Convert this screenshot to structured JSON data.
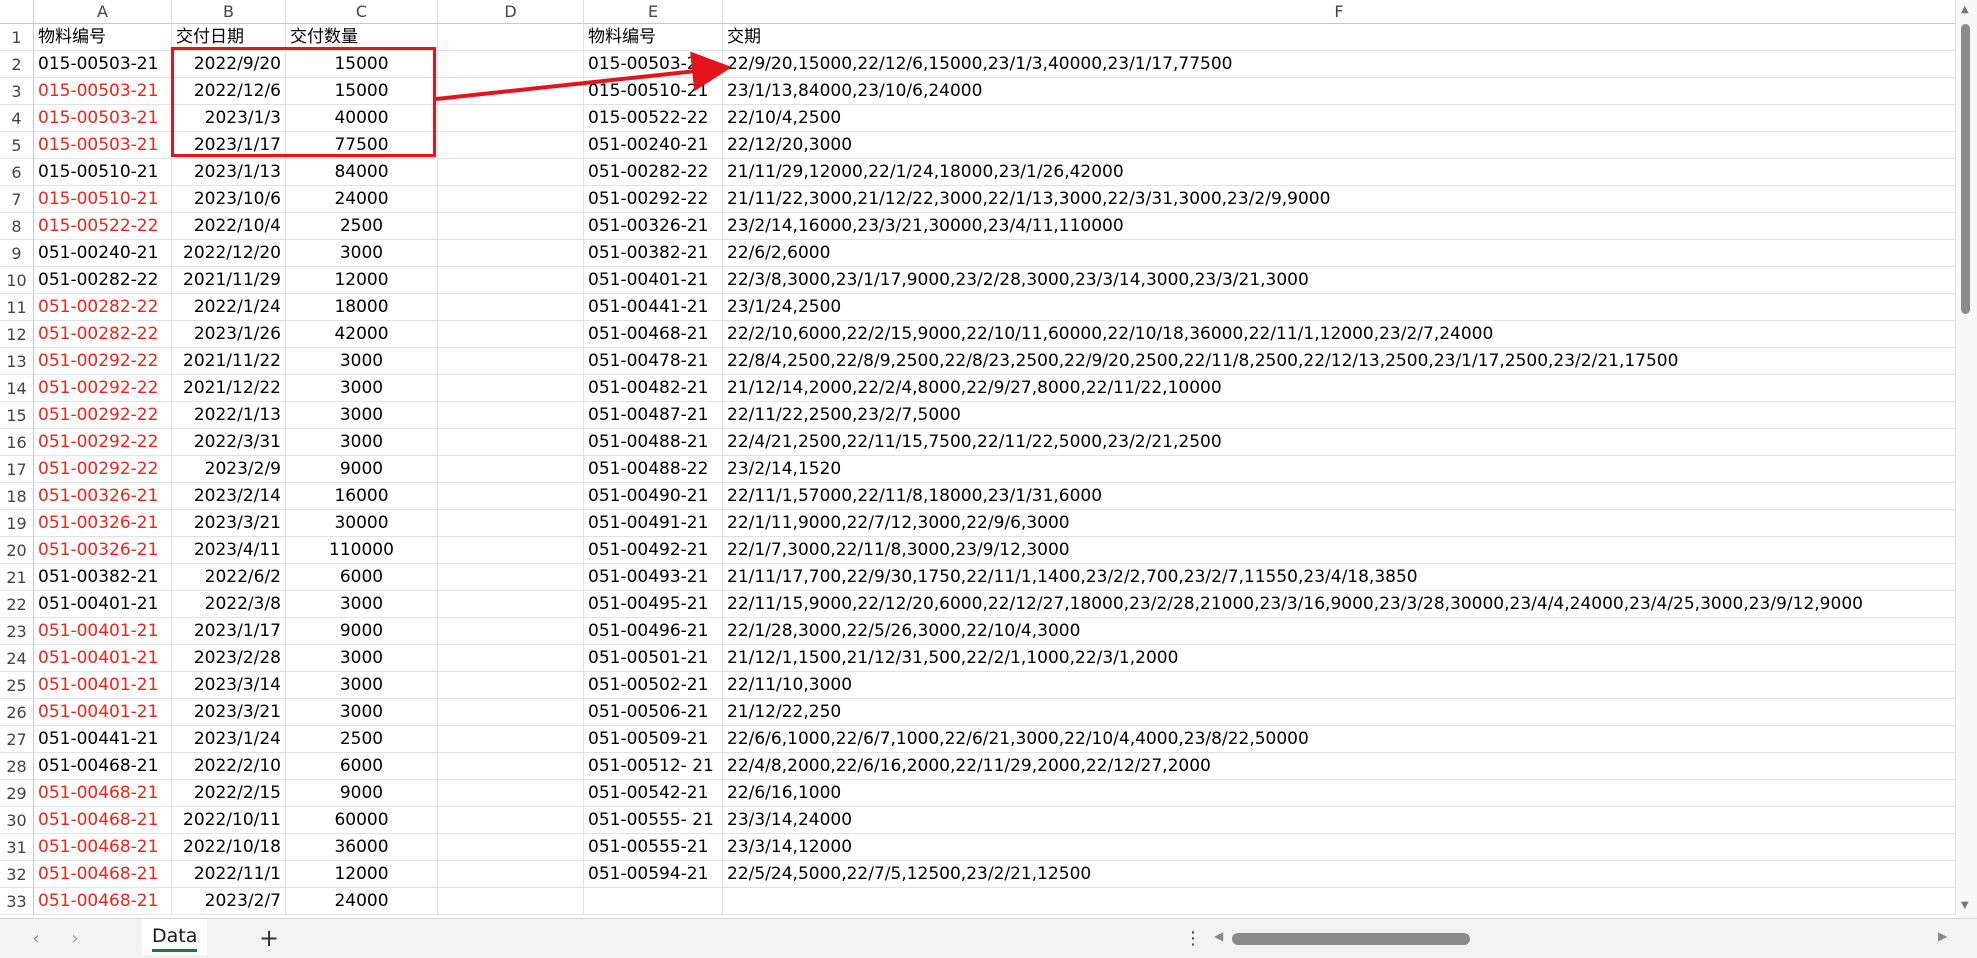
{
  "columns": [
    {
      "letter": "A"
    },
    {
      "letter": "B"
    },
    {
      "letter": "C"
    },
    {
      "letter": "D"
    },
    {
      "letter": "E"
    },
    {
      "letter": "F"
    }
  ],
  "headers": {
    "a": "物料编号",
    "b": "交付日期",
    "c": "交付数量",
    "e": "物料编号",
    "f": "交期"
  },
  "left_rows": [
    {
      "code": "015-00503-21",
      "date": "2022/9/20",
      "qty": "15000",
      "red": false
    },
    {
      "code": "015-00503-21",
      "date": "2022/12/6",
      "qty": "15000",
      "red": true
    },
    {
      "code": "015-00503-21",
      "date": "2023/1/3",
      "qty": "40000",
      "red": true
    },
    {
      "code": "015-00503-21",
      "date": "2023/1/17",
      "qty": "77500",
      "red": true
    },
    {
      "code": "015-00510-21",
      "date": "2023/1/13",
      "qty": "84000",
      "red": false
    },
    {
      "code": "015-00510-21",
      "date": "2023/10/6",
      "qty": "24000",
      "red": true
    },
    {
      "code": "015-00522-22",
      "date": "2022/10/4",
      "qty": "2500",
      "red": true
    },
    {
      "code": "051-00240-21",
      "date": "2022/12/20",
      "qty": "3000",
      "red": false
    },
    {
      "code": "051-00282-22",
      "date": "2021/11/29",
      "qty": "12000",
      "red": false
    },
    {
      "code": "051-00282-22",
      "date": "2022/1/24",
      "qty": "18000",
      "red": true
    },
    {
      "code": "051-00282-22",
      "date": "2023/1/26",
      "qty": "42000",
      "red": true
    },
    {
      "code": "051-00292-22",
      "date": "2021/11/22",
      "qty": "3000",
      "red": true
    },
    {
      "code": "051-00292-22",
      "date": "2021/12/22",
      "qty": "3000",
      "red": true
    },
    {
      "code": "051-00292-22",
      "date": "2022/1/13",
      "qty": "3000",
      "red": true
    },
    {
      "code": "051-00292-22",
      "date": "2022/3/31",
      "qty": "3000",
      "red": true
    },
    {
      "code": "051-00292-22",
      "date": "2023/2/9",
      "qty": "9000",
      "red": true
    },
    {
      "code": "051-00326-21",
      "date": "2023/2/14",
      "qty": "16000",
      "red": true
    },
    {
      "code": "051-00326-21",
      "date": "2023/3/21",
      "qty": "30000",
      "red": true
    },
    {
      "code": "051-00326-21",
      "date": "2023/4/11",
      "qty": "110000",
      "red": true
    },
    {
      "code": "051-00382-21",
      "date": "2022/6/2",
      "qty": "6000",
      "red": false
    },
    {
      "code": "051-00401-21",
      "date": "2022/3/8",
      "qty": "3000",
      "red": false
    },
    {
      "code": "051-00401-21",
      "date": "2023/1/17",
      "qty": "9000",
      "red": true
    },
    {
      "code": "051-00401-21",
      "date": "2023/2/28",
      "qty": "3000",
      "red": true
    },
    {
      "code": "051-00401-21",
      "date": "2023/3/14",
      "qty": "3000",
      "red": true
    },
    {
      "code": "051-00401-21",
      "date": "2023/3/21",
      "qty": "3000",
      "red": true
    },
    {
      "code": "051-00441-21",
      "date": "2023/1/24",
      "qty": "2500",
      "red": false
    },
    {
      "code": "051-00468-21",
      "date": "2022/2/10",
      "qty": "6000",
      "red": false
    },
    {
      "code": "051-00468-21",
      "date": "2022/2/15",
      "qty": "9000",
      "red": true
    },
    {
      "code": "051-00468-21",
      "date": "2022/10/11",
      "qty": "60000",
      "red": true
    },
    {
      "code": "051-00468-21",
      "date": "2022/10/18",
      "qty": "36000",
      "red": true
    },
    {
      "code": "051-00468-21",
      "date": "2022/11/1",
      "qty": "12000",
      "red": true
    },
    {
      "code": "051-00468-21",
      "date": "2023/2/7",
      "qty": "24000",
      "red": true
    }
  ],
  "right_rows": [
    {
      "code": "015-00503-21",
      "terms": "22/9/20,15000,22/12/6,15000,23/1/3,40000,23/1/17,77500"
    },
    {
      "code": "015-00510-21",
      "terms": "23/1/13,84000,23/10/6,24000"
    },
    {
      "code": "015-00522-22",
      "terms": "22/10/4,2500"
    },
    {
      "code": "051-00240-21",
      "terms": "22/12/20,3000"
    },
    {
      "code": "051-00282-22",
      "terms": "21/11/29,12000,22/1/24,18000,23/1/26,42000"
    },
    {
      "code": "051-00292-22",
      "terms": "21/11/22,3000,21/12/22,3000,22/1/13,3000,22/3/31,3000,23/2/9,9000"
    },
    {
      "code": "051-00326-21",
      "terms": "23/2/14,16000,23/3/21,30000,23/4/11,110000"
    },
    {
      "code": "051-00382-21",
      "terms": "22/6/2,6000"
    },
    {
      "code": "051-00401-21",
      "terms": "22/3/8,3000,23/1/17,9000,23/2/28,3000,23/3/14,3000,23/3/21,3000"
    },
    {
      "code": "051-00441-21",
      "terms": "23/1/24,2500"
    },
    {
      "code": "051-00468-21",
      "terms": "22/2/10,6000,22/2/15,9000,22/10/11,60000,22/10/18,36000,22/11/1,12000,23/2/7,24000"
    },
    {
      "code": "051-00478-21",
      "terms": "22/8/4,2500,22/8/9,2500,22/8/23,2500,22/9/20,2500,22/11/8,2500,22/12/13,2500,23/1/17,2500,23/2/21,17500"
    },
    {
      "code": "051-00482-21",
      "terms": "21/12/14,2000,22/2/4,8000,22/9/27,8000,22/11/22,10000"
    },
    {
      "code": "051-00487-21",
      "terms": "22/11/22,2500,23/2/7,5000"
    },
    {
      "code": "051-00488-21",
      "terms": "22/4/21,2500,22/11/15,7500,22/11/22,5000,23/2/21,2500"
    },
    {
      "code": "051-00488-22",
      "terms": "23/2/14,1520"
    },
    {
      "code": "051-00490-21",
      "terms": "22/11/1,57000,22/11/8,18000,23/1/31,6000"
    },
    {
      "code": "051-00491-21",
      "terms": "22/1/11,9000,22/7/12,3000,22/9/6,3000"
    },
    {
      "code": "051-00492-21",
      "terms": "22/1/7,3000,22/11/8,3000,23/9/12,3000"
    },
    {
      "code": "051-00493-21",
      "terms": "21/11/17,700,22/9/30,1750,22/11/1,1400,23/2/2,700,23/2/7,11550,23/4/18,3850"
    },
    {
      "code": "051-00495-21",
      "terms": "22/11/15,9000,22/12/20,6000,22/12/27,18000,23/2/28,21000,23/3/16,9000,23/3/28,30000,23/4/4,24000,23/4/25,3000,23/9/12,9000"
    },
    {
      "code": "051-00496-21",
      "terms": "22/1/28,3000,22/5/26,3000,22/10/4,3000"
    },
    {
      "code": "051-00501-21",
      "terms": "21/12/1,1500,21/12/31,500,22/2/1,1000,22/3/1,2000"
    },
    {
      "code": "051-00502-21",
      "terms": "22/11/10,3000"
    },
    {
      "code": "051-00506-21",
      "terms": "21/12/22,250"
    },
    {
      "code": "051-00509-21",
      "terms": "22/6/6,1000,22/6/7,1000,22/6/21,3000,22/10/4,4000,23/8/22,50000"
    },
    {
      "code": "051-00512- 21",
      "terms": "22/4/8,2000,22/6/16,2000,22/11/29,2000,22/12/27,2000"
    },
    {
      "code": "051-00542-21",
      "terms": "22/6/16,1000"
    },
    {
      "code": "051-00555- 21",
      "terms": "23/3/14,24000"
    },
    {
      "code": "051-00555-21",
      "terms": "23/3/14,12000"
    },
    {
      "code": "051-00594-21",
      "terms": "22/5/24,5000,22/7/5,12500,23/2/21,12500"
    },
    {
      "code": "",
      "terms": ""
    }
  ],
  "row_numbers": [
    "1",
    "2",
    "3",
    "4",
    "5",
    "6",
    "7",
    "8",
    "9",
    "10",
    "11",
    "12",
    "13",
    "14",
    "15",
    "16",
    "17",
    "18",
    "19",
    "20",
    "21",
    "22",
    "23",
    "24",
    "25",
    "26",
    "27",
    "28",
    "29",
    "30",
    "31",
    "32",
    "33"
  ],
  "colors": {
    "red_text": "#e8261b",
    "highlight_border": "#e3141b",
    "tab_underline": "#1d7a3a"
  },
  "tabbar": {
    "sheet_tab": "Data",
    "add_icon": "plus-icon",
    "prev_icon": "chevron-left-icon",
    "next_icon": "chevron-right-icon",
    "more_icon": "more-vertical-icon"
  }
}
